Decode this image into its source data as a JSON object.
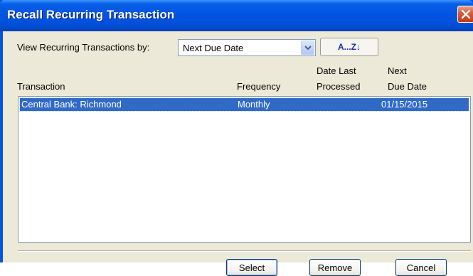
{
  "window": {
    "title": "Recall Recurring Transaction"
  },
  "view_by": {
    "label": "View Recurring Transactions by:",
    "selected": "Next Due Date",
    "sort_button": "A...Z↓"
  },
  "table": {
    "columns": {
      "transaction": "Transaction",
      "frequency": "Frequency",
      "date_last_processed_line1": "Date Last",
      "date_last_processed_line2": "Processed",
      "next_due_date_line1": "Next",
      "next_due_date_line2": "Due Date"
    },
    "rows": [
      {
        "transaction": "Central Bank: Richmond",
        "frequency": "Monthly",
        "date_last_processed": "",
        "next_due_date": "01/15/2015"
      }
    ]
  },
  "buttons": {
    "select": "Select",
    "remove": "Remove",
    "cancel": "Cancel"
  },
  "colors": {
    "title_bar": "#0054e3",
    "dialog_bg": "#ece9d8",
    "selection": "#316ac5"
  }
}
